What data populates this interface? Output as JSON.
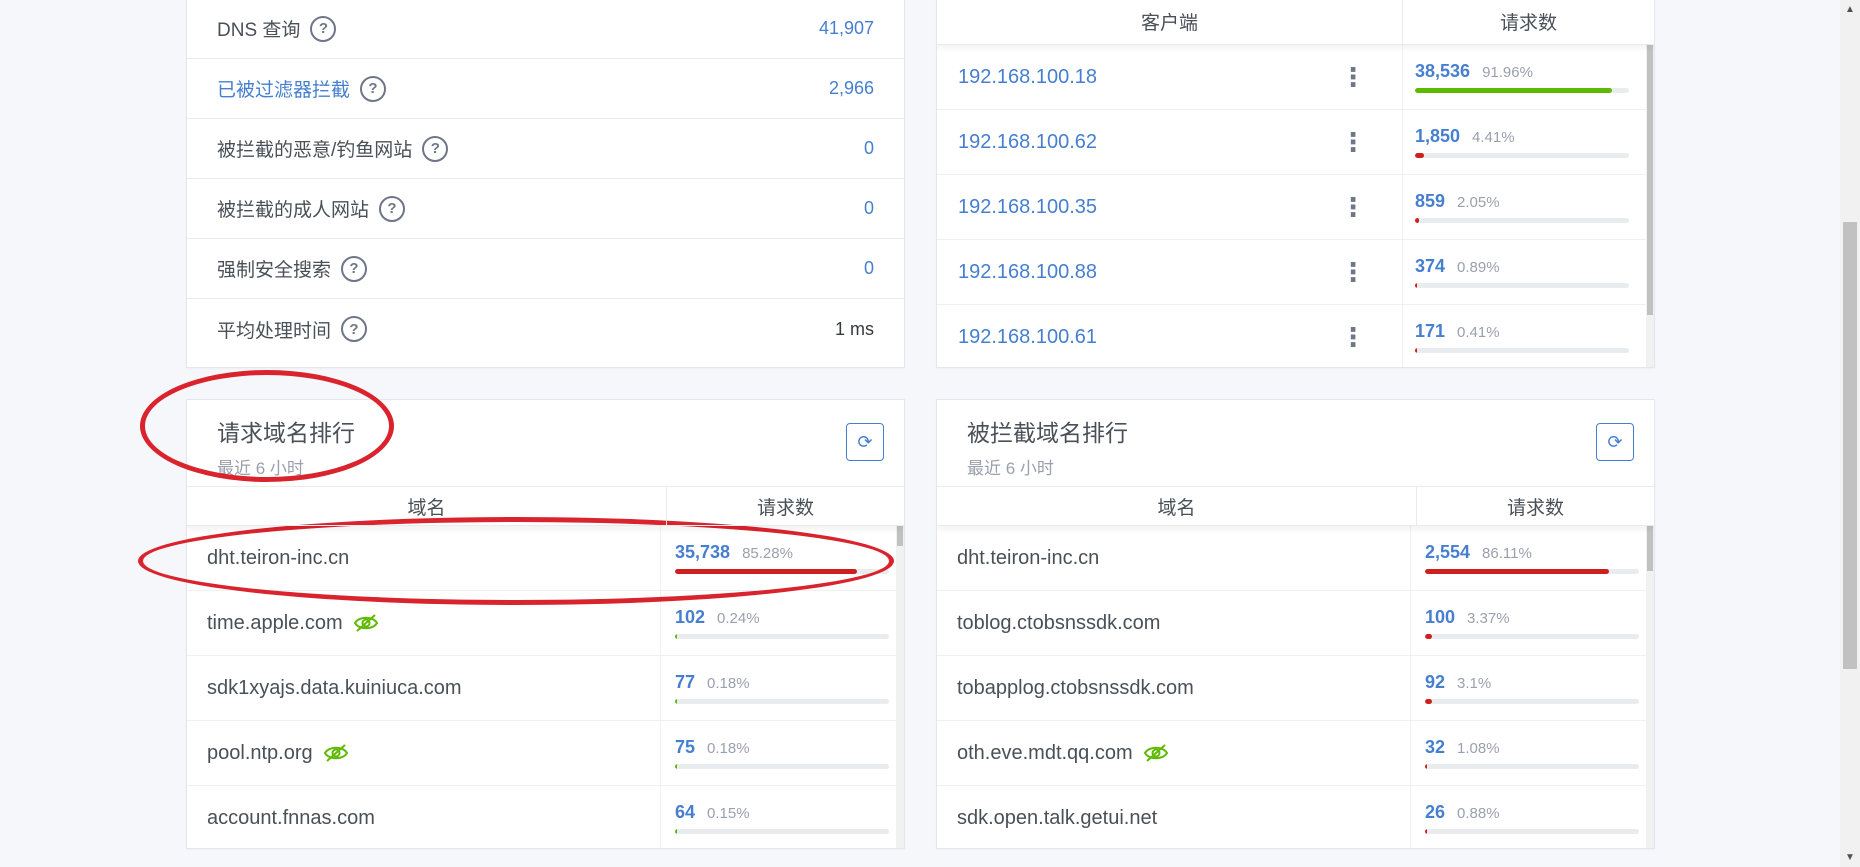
{
  "stats": [
    {
      "label": "DNS 查询",
      "value": "41,907",
      "link": false,
      "plain": false
    },
    {
      "label": "已被过滤器拦截",
      "value": "2,966",
      "link": true,
      "plain": false
    },
    {
      "label": "被拦截的恶意/钓鱼网站",
      "value": "0",
      "link": false,
      "plain": false
    },
    {
      "label": "被拦截的成人网站",
      "value": "0",
      "link": false,
      "plain": false
    },
    {
      "label": "强制安全搜索",
      "value": "0",
      "link": false,
      "plain": false
    },
    {
      "label": "平均处理时间",
      "value": "1 ms",
      "link": false,
      "plain": true
    }
  ],
  "help_glyph": "?",
  "kebab_glyph": "⋮",
  "refresh_glyph": "⟳",
  "clients": {
    "col_client": "客户端",
    "col_requests": "请求数",
    "rows": [
      {
        "ip": "192.168.100.18",
        "count": "38,536",
        "pct": "91.96%",
        "fill": 0.9196,
        "color": "#5eba00"
      },
      {
        "ip": "192.168.100.62",
        "count": "1,850",
        "pct": "4.41%",
        "fill": 0.0441,
        "color": "#cd201f"
      },
      {
        "ip": "192.168.100.35",
        "count": "859",
        "pct": "2.05%",
        "fill": 0.0205,
        "color": "#cd201f"
      },
      {
        "ip": "192.168.100.88",
        "count": "374",
        "pct": "0.89%",
        "fill": 0.0089,
        "color": "#cd201f"
      },
      {
        "ip": "192.168.100.61",
        "count": "171",
        "pct": "0.41%",
        "fill": 0.0041,
        "color": "#cd201f"
      }
    ]
  },
  "top_domains": {
    "title": "请求域名排行",
    "subtitle": "最近 6 小时",
    "col_domain": "域名",
    "col_requests": "请求数",
    "rows": [
      {
        "domain": "dht.teiron-inc.cn",
        "count": "35,738",
        "pct": "85.28%",
        "fill": 0.8528,
        "color": "#cd201f",
        "eye": false
      },
      {
        "domain": "time.apple.com",
        "count": "102",
        "pct": "0.24%",
        "fill": 0.0024,
        "color": "#5eba00",
        "eye": true
      },
      {
        "domain": "sdk1xyajs.data.kuiniuca.com",
        "count": "77",
        "pct": "0.18%",
        "fill": 0.0018,
        "color": "#5eba00",
        "eye": false
      },
      {
        "domain": "pool.ntp.org",
        "count": "75",
        "pct": "0.18%",
        "fill": 0.0018,
        "color": "#5eba00",
        "eye": true
      },
      {
        "domain": "account.fnnas.com",
        "count": "64",
        "pct": "0.15%",
        "fill": 0.0015,
        "color": "#5eba00",
        "eye": false
      }
    ]
  },
  "blocked_domains": {
    "title": "被拦截域名排行",
    "subtitle": "最近 6 小时",
    "col_domain": "域名",
    "col_requests": "请求数",
    "rows": [
      {
        "domain": "dht.teiron-inc.cn",
        "count": "2,554",
        "pct": "86.11%",
        "fill": 0.8611,
        "color": "#cd201f",
        "eye": false
      },
      {
        "domain": "toblog.ctobsnssdk.com",
        "count": "100",
        "pct": "3.37%",
        "fill": 0.0337,
        "color": "#cd201f",
        "eye": false
      },
      {
        "domain": "tobapplog.ctobsnssdk.com",
        "count": "92",
        "pct": "3.1%",
        "fill": 0.031,
        "color": "#cd201f",
        "eye": false
      },
      {
        "domain": "oth.eve.mdt.qq.com",
        "count": "32",
        "pct": "1.08%",
        "fill": 0.0108,
        "color": "#cd201f",
        "eye": true
      },
      {
        "domain": "sdk.open.talk.getui.net",
        "count": "26",
        "pct": "0.88%",
        "fill": 0.0088,
        "color": "#cd201f",
        "eye": false
      }
    ]
  },
  "colors": {
    "accent": "#467fcf",
    "annotation": "#d9232d",
    "green": "#5eba00",
    "red": "#cd201f",
    "eye_icon": "#5eba00"
  },
  "icons": [
    "help-icon",
    "kebab-menu-icon",
    "refresh-icon",
    "eye-slash-icon"
  ]
}
